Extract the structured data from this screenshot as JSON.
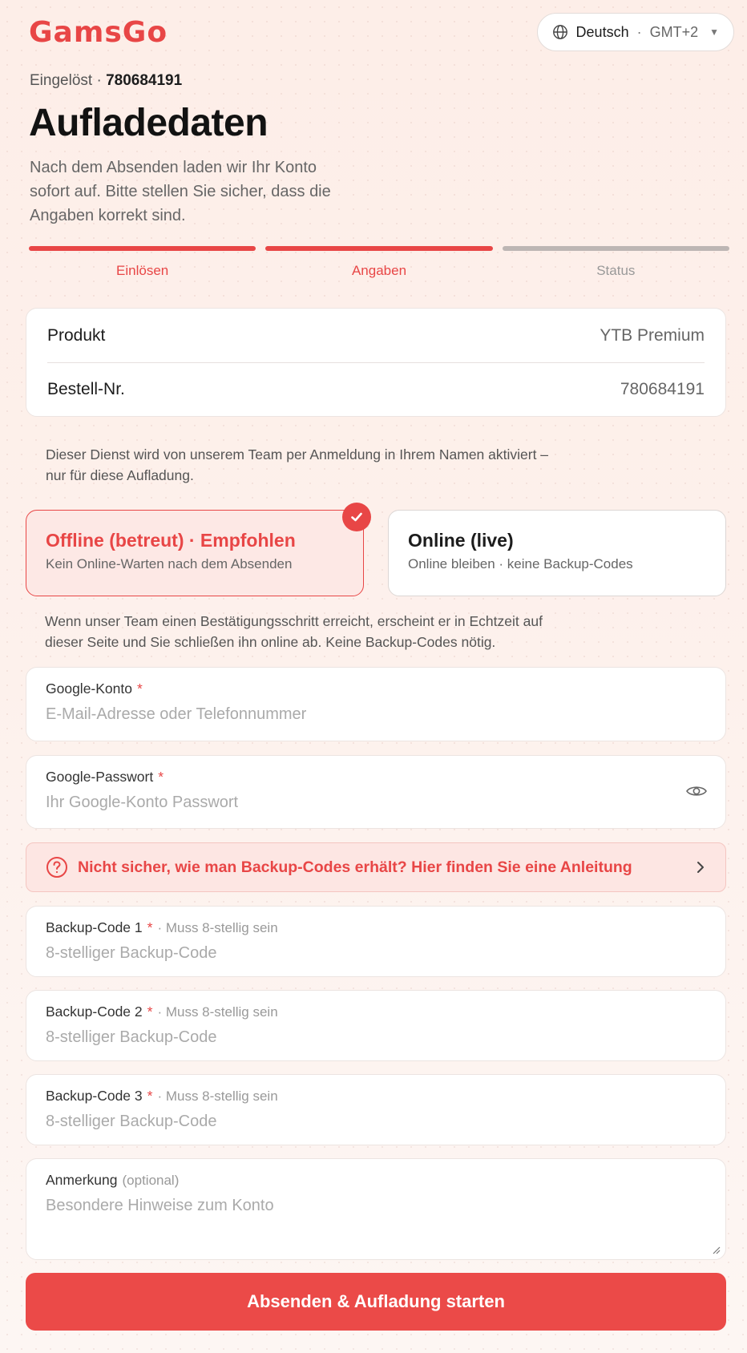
{
  "header": {
    "logo": "GamsGo",
    "language": "Deutsch",
    "separator": "·",
    "timezone": "GMT+2"
  },
  "redeemed": {
    "label": "Eingelöst ·",
    "code": "780684191"
  },
  "title": "Aufladedaten",
  "subtitle": "Nach dem Absenden laden wir Ihr Konto sofort auf. Bitte stellen Sie sicher, dass die Angaben korrekt sind.",
  "steps": [
    {
      "label": "Einlösen",
      "active": true
    },
    {
      "label": "Angaben",
      "active": true
    },
    {
      "label": "Status",
      "active": false
    }
  ],
  "info": [
    {
      "key": "Produkt",
      "value": "YTB Premium"
    },
    {
      "key": "Bestell-Nr.",
      "value": "780684191"
    }
  ],
  "service_note": "Dieser Dienst wird von unserem Team per Anmeldung in Ihrem Namen aktiviert – nur für diese Aufladung.",
  "options": [
    {
      "title": "Offline (betreut) · Empfohlen",
      "subtitle": "Kein Online-Warten nach dem Absenden",
      "selected": true
    },
    {
      "title": "Online (live)",
      "subtitle": "Online bleiben · keine Backup-Codes",
      "selected": false
    }
  ],
  "mode_note": "Wenn unser Team einen Bestätigungsschritt erreicht, erscheint er in Echtzeit auf dieser Seite und Sie schließen ihn online ab. Keine Backup-Codes nötig.",
  "fields": {
    "account": {
      "label": "Google-Konto",
      "required": "*",
      "placeholder": "E-Mail-Adresse oder Telefonnummer",
      "value": ""
    },
    "password": {
      "label": "Google-Passwort",
      "required": "*",
      "placeholder": "Ihr Google-Konto Passwort",
      "value": ""
    },
    "backup1": {
      "label": "Backup-Code 1",
      "required": "*",
      "hint": "· Muss 8-stellig sein",
      "placeholder": "8-stelliger Backup-Code",
      "value": ""
    },
    "backup2": {
      "label": "Backup-Code 2",
      "required": "*",
      "hint": "· Muss 8-stellig sein",
      "placeholder": "8-stelliger Backup-Code",
      "value": ""
    },
    "backup3": {
      "label": "Backup-Code 3",
      "required": "*",
      "hint": "· Muss 8-stellig sein",
      "placeholder": "8-stelliger Backup-Code",
      "value": ""
    },
    "remark": {
      "label": "Anmerkung",
      "hint": "(optional)",
      "placeholder": "Besondere Hinweise zum Konto",
      "value": ""
    }
  },
  "help_link": "Nicht sicher, wie man Backup-Codes erhält? Hier finden Sie eine Anleitung",
  "submit_label": "Absenden & Aufladung starten",
  "icons": {
    "language": "globe-icon",
    "caret": "caret-down-icon",
    "check": "check-icon",
    "eye": "eye-icon",
    "help": "question-circle-icon",
    "chevron": "chevron-right-icon"
  },
  "colors": {
    "accent": "#e84646",
    "button": "#eb4a48",
    "selected_bg": "#fde8e5"
  }
}
